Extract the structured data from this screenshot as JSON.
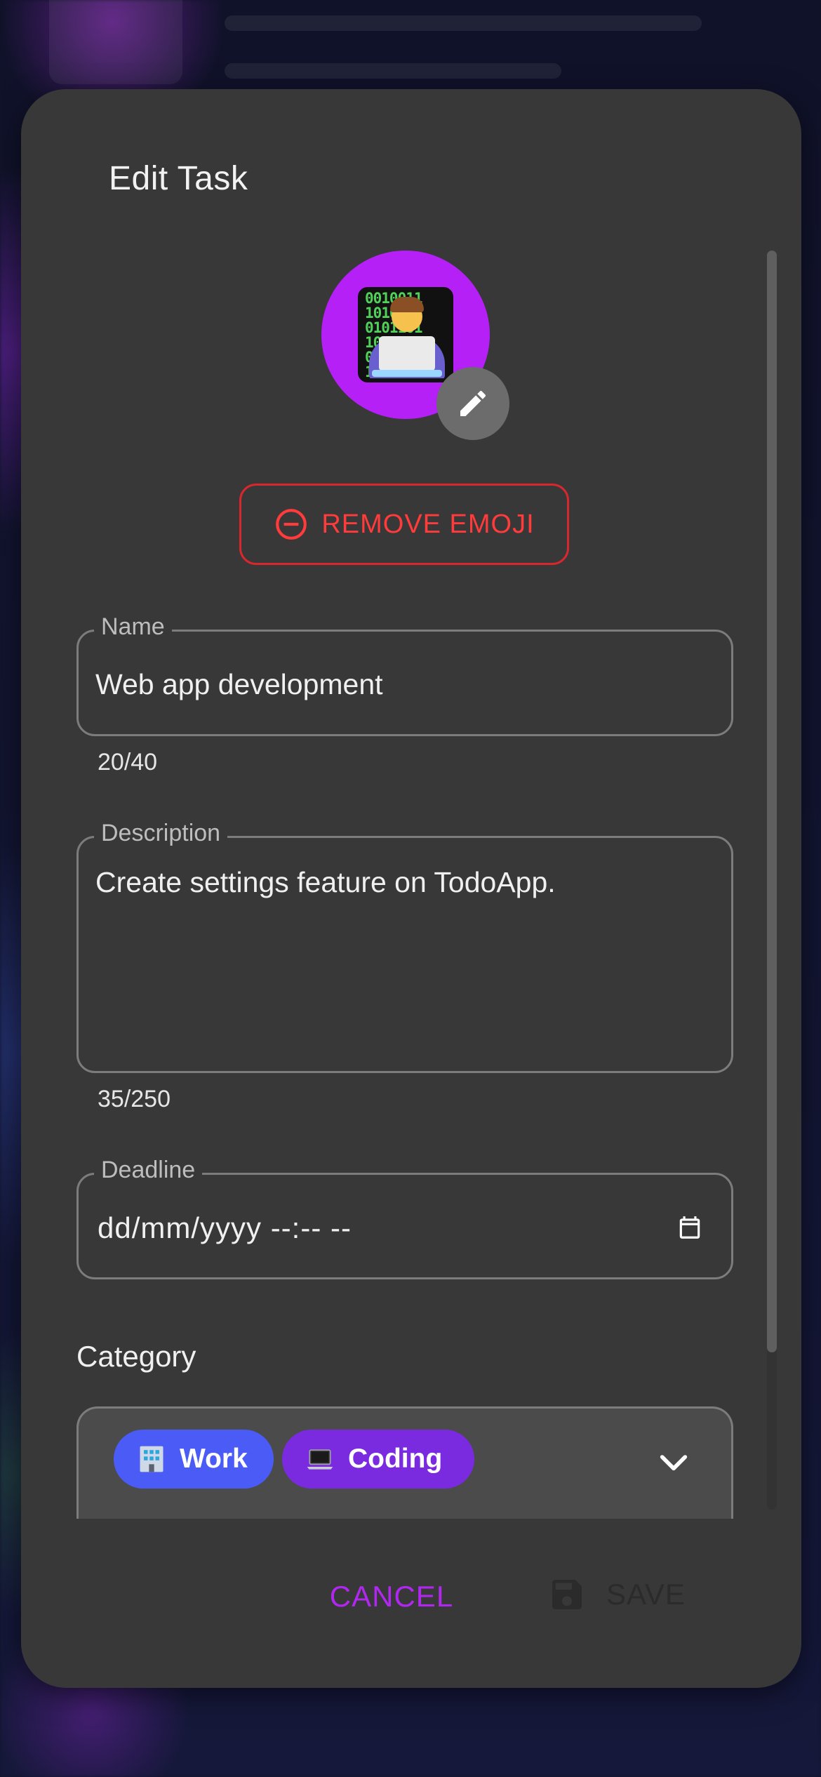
{
  "dialog": {
    "title": "Edit Task",
    "emoji": {
      "icon": "technologist-emoji",
      "background_color": "#b420f5",
      "binary_text": "0010011\n1010011\n0101101\n1001001\n0101010\n1100101"
    },
    "remove_emoji_label": "REMOVE EMOJI",
    "name_field": {
      "label": "Name",
      "value": "Web app development",
      "counter": "20/40"
    },
    "description_field": {
      "label": "Description",
      "value": "Create settings feature on TodoApp.",
      "counter": "35/250"
    },
    "deadline_field": {
      "label": "Deadline",
      "placeholder": "dd/mm/yyyy --:-- --"
    },
    "category": {
      "title": "Category",
      "chips": [
        {
          "label": "Work",
          "icon": "office-building-emoji",
          "color": "#4b5cf6"
        },
        {
          "label": "Coding",
          "icon": "laptop-emoji",
          "color": "#7a2be0"
        }
      ]
    },
    "actions": {
      "cancel_label": "CANCEL",
      "save_label": "SAVE"
    },
    "colors": {
      "accent": "#b028f0",
      "danger": "#ff3b3b",
      "surface": "#383838"
    }
  }
}
